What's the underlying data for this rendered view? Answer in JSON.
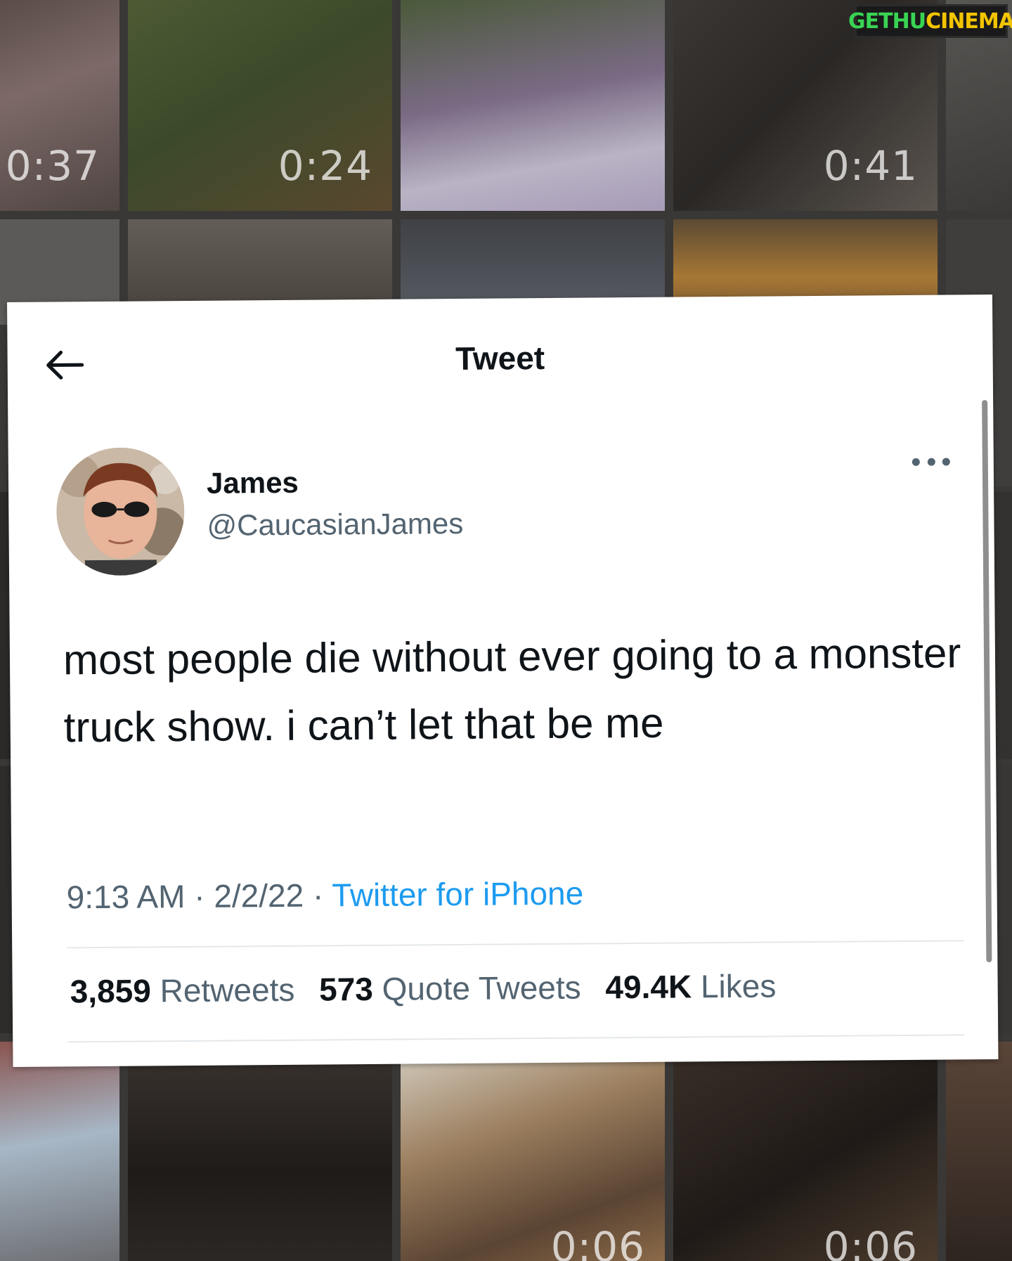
{
  "watermark": {
    "part1": "GETHU",
    "part2": "CINEMA"
  },
  "gallery": {
    "durations": [
      "0:37",
      "0:24",
      "0:41",
      "0:06",
      "0:06"
    ]
  },
  "tweet_header": {
    "title": "Tweet"
  },
  "author": {
    "name": "James",
    "handle": "@CaucasianJames"
  },
  "tweet": {
    "text": "most people die without ever going to a monster truck show. i can’t let that be me",
    "time": "9:13 AM",
    "date": "2/2/22",
    "source": "Twitter for iPhone",
    "separator": "·"
  },
  "stats": {
    "retweets_count": "3,859",
    "retweets_label": "Retweets",
    "quotes_count": "573",
    "quotes_label": "Quote Tweets",
    "likes_count": "49.4K",
    "likes_label": "Likes"
  },
  "colors": {
    "link": "#1d9bf0",
    "secondary_text": "#536471",
    "primary_text": "#0f1419"
  }
}
